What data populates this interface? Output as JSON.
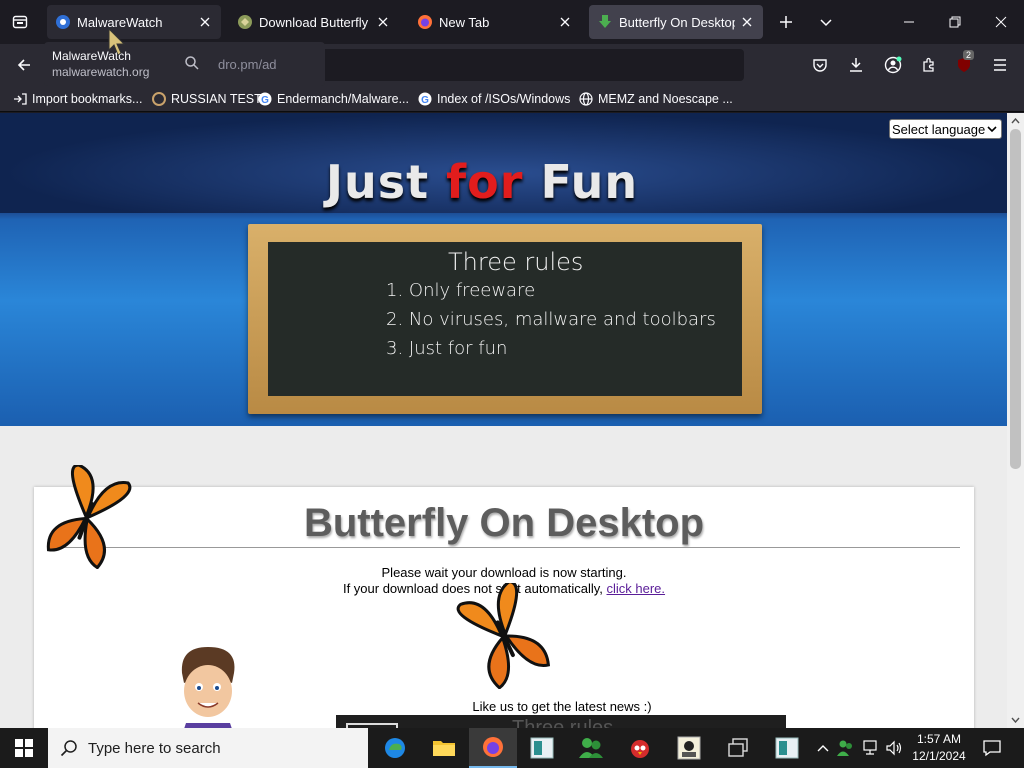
{
  "browser": {
    "tabs": [
      {
        "title": "MalwareWatch",
        "state": "hovered"
      },
      {
        "title": "Download Butterfly On",
        "state": "normal"
      },
      {
        "title": "New Tab",
        "state": "normal"
      },
      {
        "title": "Butterfly On Desktop d",
        "state": "selected"
      }
    ],
    "tooltip": {
      "title": "MalwareWatch",
      "url": "malwarewatch.org"
    },
    "url_text": "dro.pm/ad",
    "bookmarks": [
      {
        "label": "Import bookmarks...",
        "icon": "import-icon"
      },
      {
        "label": "RUSSIAN TEST",
        "icon": "site-icon"
      },
      {
        "label": "Endermanch/Malware...",
        "icon": "google-icon"
      },
      {
        "label": "Index of /ISOs/Windows",
        "icon": "google-icon"
      },
      {
        "label": "MEMZ and Noescape ...",
        "icon": "globe-icon"
      }
    ],
    "extensions_badge": "2"
  },
  "page": {
    "language_select": "Select language",
    "logo": {
      "w1": "Just",
      "w2": "for",
      "w3": "Fun"
    },
    "board": {
      "title": "Three rules",
      "rules": [
        "1. Only freeware",
        "2. No viruses, mallware and toolbars",
        "3. Just for fun"
      ]
    },
    "heading": "Butterfly On Desktop",
    "wait_msg": "Please wait your download is now starting.",
    "fallback_msg": "If your download does not start automatically,",
    "click_here": "click here.",
    "like_msg": "Like us to get the latest news :)",
    "video_ghost": "Three rules"
  },
  "taskbar": {
    "search_placeholder": "Type here to search",
    "time": "1:57 AM",
    "date": "12/1/2024"
  },
  "colors": {
    "accent_blue": "#1f63b4",
    "logo_red": "#e11d1d",
    "link_purple": "#5a1d98"
  }
}
